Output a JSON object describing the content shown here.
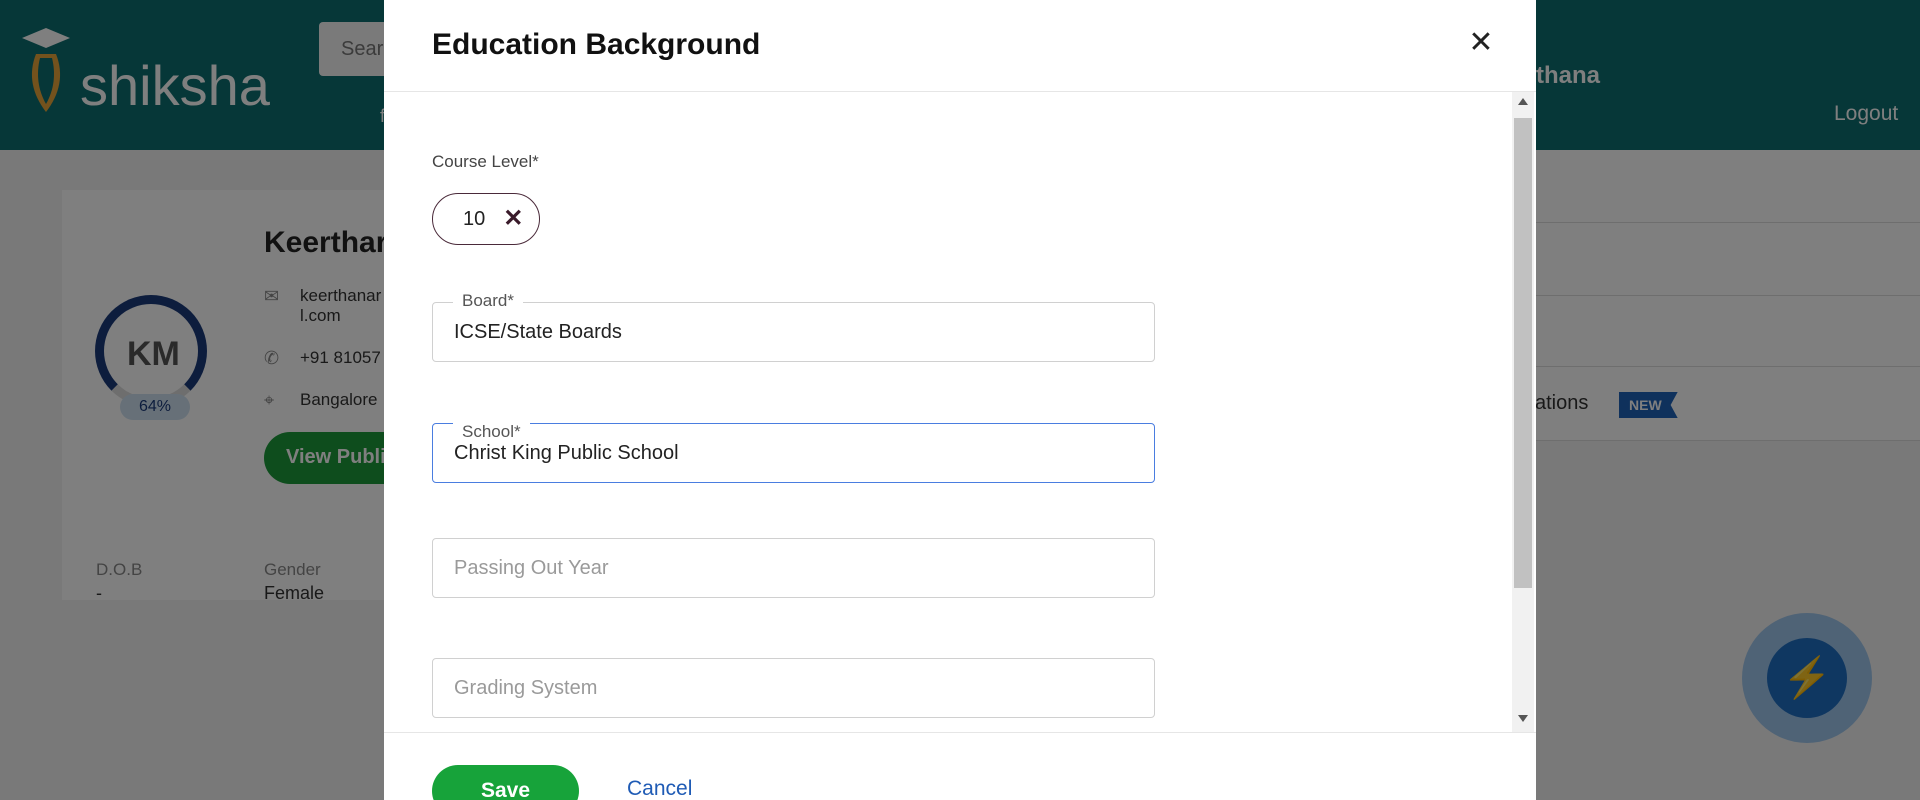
{
  "header": {
    "logo_text": "shiksha",
    "search_placeholder": "Sear",
    "nav_fragment": "f",
    "user_name_fragment": "thana",
    "logout_label": "Logout"
  },
  "profile": {
    "name_fragment": "Keerthar",
    "initials": "KM",
    "completion": "64%",
    "email_line1": "keerthanar",
    "email_line2": "l.com",
    "phone_fragment": "+91 81057",
    "location_fragment": "Bangalore",
    "view_button_fragment": "View Publi",
    "dob_label": "D.O.B",
    "dob_value": "-",
    "gender_label": "Gender",
    "gender_value": "Female"
  },
  "right_panel": {
    "item_fragment": "ations",
    "badge": "NEW"
  },
  "modal": {
    "title": "Education Background",
    "close_symbol": "✕",
    "course_level_label": "Course Level*",
    "course_level_chip": "10",
    "chip_remove_symbol": "✕",
    "board": {
      "label": "Board*",
      "value": "ICSE/State Boards"
    },
    "school": {
      "label": "School*",
      "value": "Christ King Public School"
    },
    "passing_year": {
      "placeholder": "Passing Out Year"
    },
    "grading_system": {
      "placeholder": "Grading System"
    },
    "save_label": "Save",
    "cancel_label": "Cancel"
  },
  "colors": {
    "header_teal": "#0c6e70",
    "save_green": "#17a33a",
    "link_blue": "#1f5bb5",
    "focus_blue": "#4a7de0"
  }
}
